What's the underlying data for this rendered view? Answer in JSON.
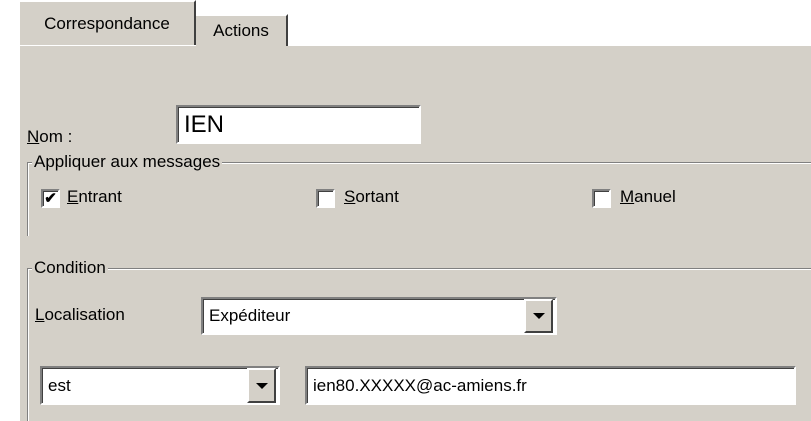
{
  "tabs": [
    {
      "label": "Correspondance",
      "active": true
    },
    {
      "label": "Actions",
      "active": false
    }
  ],
  "name_field": {
    "label_accel": "N",
    "label_rest": "om :",
    "value": "IEN"
  },
  "apply_group": {
    "legend": "Appliquer aux messages",
    "options": [
      {
        "accel": "E",
        "rest": "ntrant",
        "checked": true,
        "check_glyph": "✔"
      },
      {
        "accel": "S",
        "rest": "ortant",
        "checked": false,
        "check_glyph": ""
      },
      {
        "accel": "M",
        "rest": "anuel",
        "checked": false,
        "check_glyph": ""
      }
    ]
  },
  "condition_group": {
    "legend": "Condition",
    "location": {
      "label_accel": "L",
      "label_rest": "ocalisation",
      "selected": "Expéditeur"
    },
    "operator": {
      "selected": "est"
    },
    "value": "ien80.XXXXX@ac-amiens.fr"
  },
  "colors": {
    "face": "#d4d0c8",
    "shadow": "#808080",
    "highlight": "#ffffff"
  }
}
